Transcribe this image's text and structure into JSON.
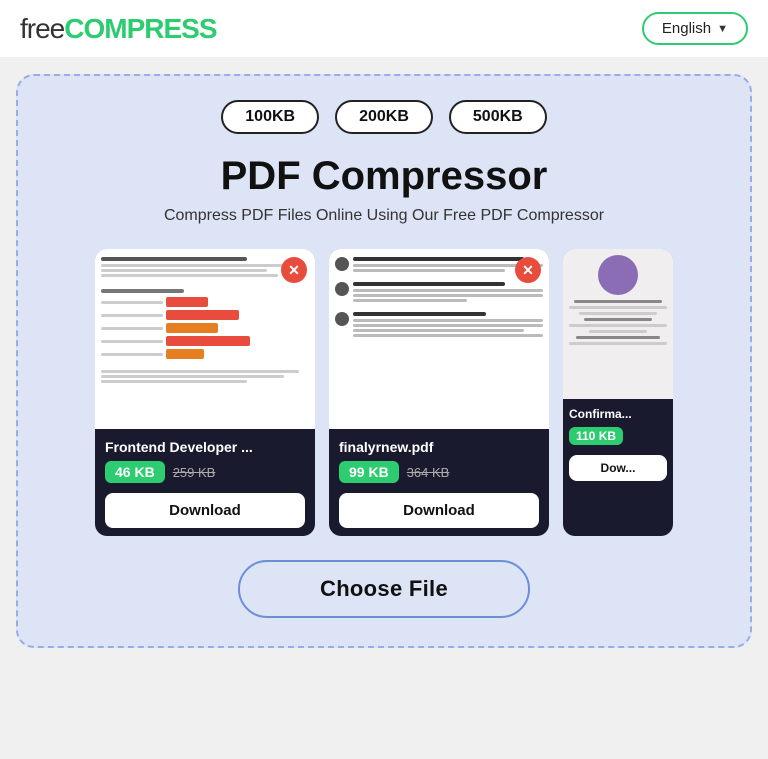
{
  "header": {
    "logo_free": "free",
    "logo_compress": "COMPRESS",
    "lang_label": "English",
    "lang_chevron": "▼"
  },
  "size_buttons": [
    "100KB",
    "200KB",
    "500KB"
  ],
  "title": "PDF Compressor",
  "subtitle": "Compress PDF Files Online Using Our Free PDF Compressor",
  "cards": [
    {
      "filename": "Frontend Developer ...",
      "size_new": "46 KB",
      "size_old": "259 KB",
      "download_label": "Download",
      "has_close": true,
      "type": "doc1"
    },
    {
      "filename": "finalyrnew.pdf",
      "size_new": "99 KB",
      "size_old": "364 KB",
      "download_label": "Download",
      "has_close": true,
      "type": "doc2"
    },
    {
      "filename": "Confirma...",
      "size_new": "110 KB",
      "size_old": "",
      "download_label": "Dow...",
      "has_close": false,
      "type": "doc3",
      "partial": true
    }
  ],
  "choose_file_label": "Choose File"
}
